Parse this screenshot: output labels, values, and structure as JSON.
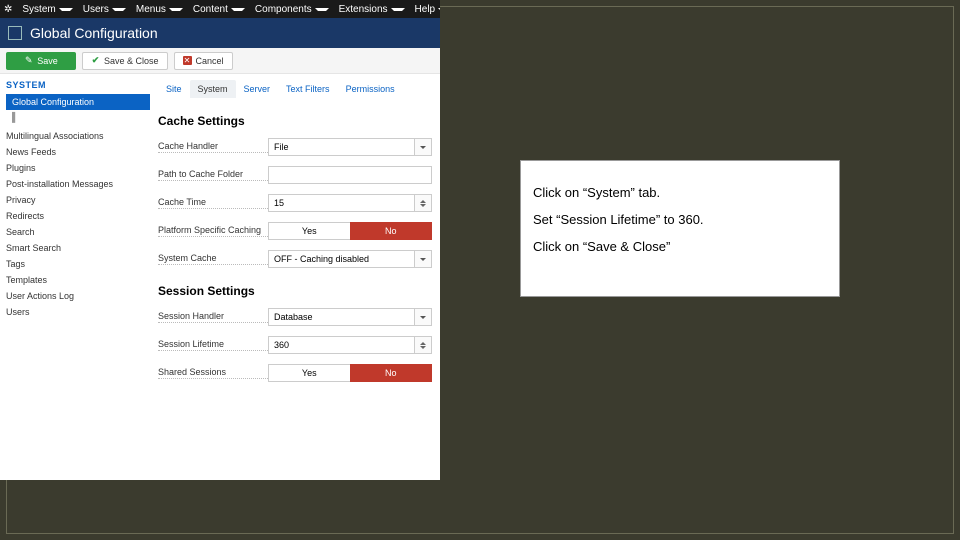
{
  "top_menu": [
    "System",
    "Users",
    "Menus",
    "Content",
    "Components",
    "Extensions",
    "Help"
  ],
  "header_title": "Global Configuration",
  "actions": {
    "save": "Save",
    "save_close": "Save & Close",
    "cancel": "Cancel"
  },
  "sidebar": {
    "title": "SYSTEM",
    "active": "Global Configuration",
    "items": [
      "Multilingual Associations",
      "News Feeds",
      "Plugins",
      "Post-installation Messages",
      "Privacy",
      "Redirects",
      "Search",
      "Smart Search",
      "Tags",
      "Templates",
      "User Actions Log",
      "Users"
    ]
  },
  "tabs": [
    "Site",
    "System",
    "Server",
    "Text Filters",
    "Permissions"
  ],
  "active_tab": "System",
  "cache_section": {
    "title": "Cache Settings",
    "handler_label": "Cache Handler",
    "handler_value": "File",
    "path_label": "Path to Cache Folder",
    "path_value": "",
    "time_label": "Cache Time",
    "time_value": "15",
    "psc_label": "Platform Specific Caching",
    "psc_yes": "Yes",
    "psc_no": "No",
    "syscache_label": "System Cache",
    "syscache_value": "OFF - Caching disabled"
  },
  "session_section": {
    "title": "Session Settings",
    "handler_label": "Session Handler",
    "handler_value": "Database",
    "lifetime_label": "Session Lifetime",
    "lifetime_value": "360",
    "shared_label": "Shared Sessions",
    "shared_yes": "Yes",
    "shared_no": "No"
  },
  "instructions": {
    "line1": "Click on “System” tab.",
    "line2": "Set “Session Lifetime” to 360.",
    "line3": "Click on “Save & Close”"
  }
}
